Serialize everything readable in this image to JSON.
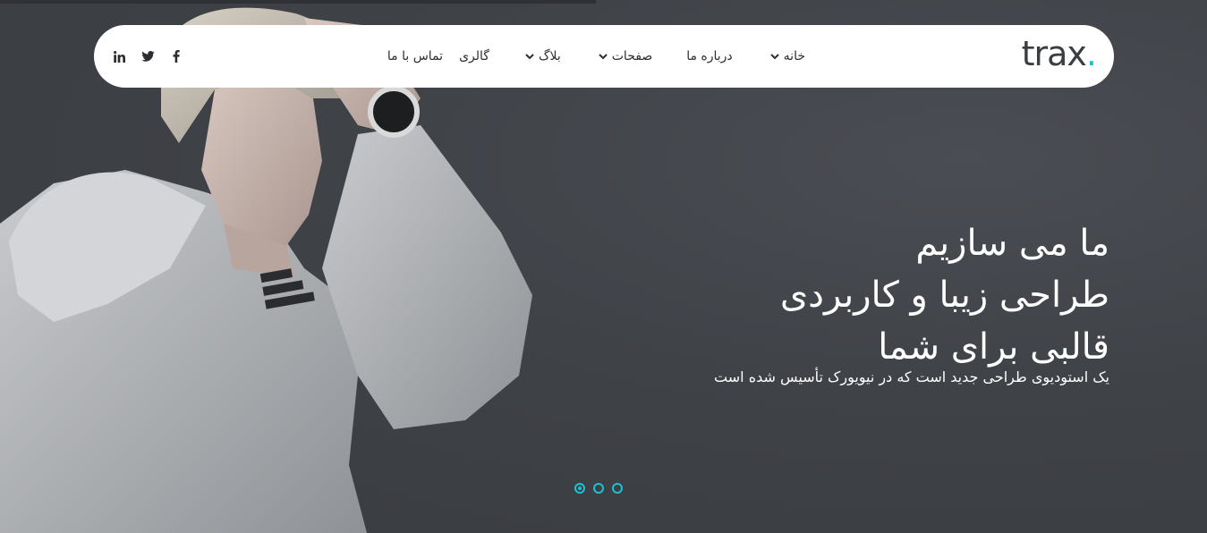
{
  "brand": {
    "logo_text": "trax",
    "logo_dot": ".",
    "accent_color": "#19c3d3"
  },
  "nav": {
    "items": [
      {
        "label": "خانه",
        "has_dropdown": true
      },
      {
        "label": "درباره ما",
        "has_dropdown": false
      },
      {
        "label": "صفحات",
        "has_dropdown": true
      },
      {
        "label": "بلاگ",
        "has_dropdown": true
      },
      {
        "label": "گالری",
        "has_dropdown": false
      },
      {
        "label": "تماس با ما",
        "has_dropdown": false
      }
    ],
    "social": [
      {
        "icon": "facebook-icon"
      },
      {
        "icon": "twitter-icon"
      },
      {
        "icon": "linkedin-icon"
      }
    ]
  },
  "hero": {
    "line1": "ما می سازیم",
    "line2": "طراحی زیبا و کاربردی",
    "line3": "قالبی برای شما",
    "subtitle": "یک استودیوی طراحی جدید است که در نیویورک تأسیس شده است",
    "slides": [
      {
        "active": true
      },
      {
        "active": false
      },
      {
        "active": false
      }
    ]
  }
}
